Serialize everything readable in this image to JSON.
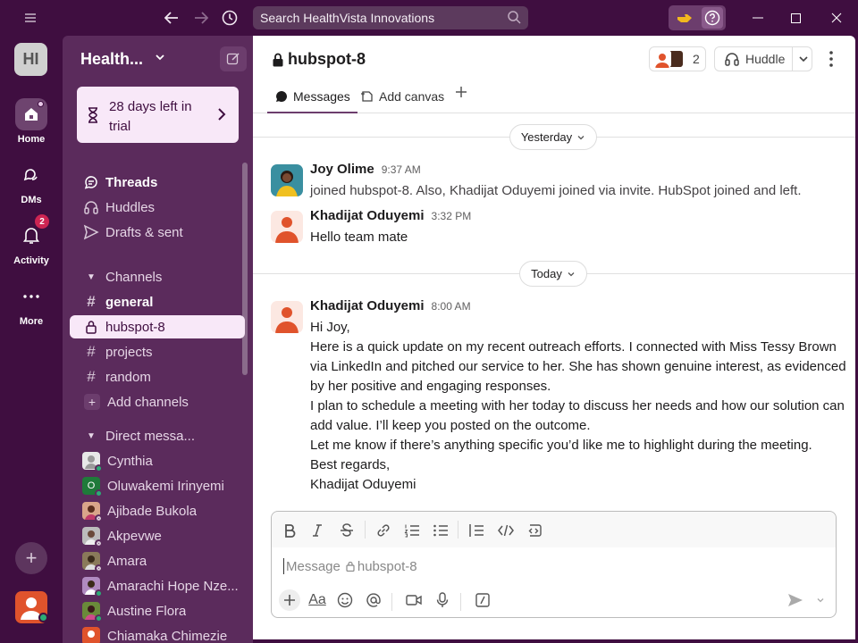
{
  "search": {
    "placeholder": "Search HealthVista Innovations"
  },
  "workspace": {
    "initials": "HI",
    "name": "Health..."
  },
  "rail": {
    "home": "Home",
    "dms": "DMs",
    "activity": "Activity",
    "activity_badge": "2",
    "more": "More"
  },
  "trial": {
    "text": "28 days left in trial"
  },
  "nav": {
    "threads": "Threads",
    "huddles": "Huddles",
    "drafts": "Drafts & sent"
  },
  "channels": {
    "header": "Channels",
    "items": [
      {
        "name": "general",
        "bold": true
      },
      {
        "name": "hubspot-8",
        "active": true
      },
      {
        "name": "projects"
      },
      {
        "name": "random"
      }
    ],
    "add": "Add channels"
  },
  "dms": {
    "header": "Direct messa...",
    "items": [
      {
        "name": "Cynthia"
      },
      {
        "name": "Oluwakemi Irinyemi",
        "initial": "O"
      },
      {
        "name": "Ajibade Bukola"
      },
      {
        "name": "Akpevwe"
      },
      {
        "name": "Amara"
      },
      {
        "name": "Amarachi Hope Nze..."
      },
      {
        "name": "Austine Flora"
      },
      {
        "name": "Chiamaka Chimezie"
      }
    ]
  },
  "channel": {
    "title": "hubspot-8",
    "member_count": "2",
    "huddle": "Huddle",
    "tabs": {
      "messages": "Messages",
      "canvas": "Add canvas"
    }
  },
  "dividers": {
    "yesterday": "Yesterday",
    "today": "Today"
  },
  "messages": [
    {
      "name": "Joy Olime",
      "time": "9:37 AM",
      "lines": [
        "joined hubspot-8. Also, Khadijat Oduyemi joined via invite. HubSpot joined and left."
      ]
    },
    {
      "name": "Khadijat Oduyemi",
      "time": "3:32 PM",
      "lines": [
        "Hello team mate"
      ]
    },
    {
      "name": "Khadijat Oduyemi",
      "time": "8:00 AM",
      "lines": [
        "Hi Joy,",
        "Here is a quick update on my recent outreach efforts. I connected with Miss Tessy Brown via LinkedIn and pitched our service to her. She has shown genuine interest, as evidenced by her positive and engaging responses.",
        "I plan to schedule a meeting with her today to discuss her needs and how our solution can add value. I’ll keep you posted on the outcome.",
        "Let me know if there’s anything specific you’d like me to highlight during the meeting.",
        "Best regards,",
        "Khadijat Oduyemi"
      ]
    }
  ],
  "composer": {
    "placeholder_prefix": "Message",
    "placeholder_channel": "hubspot-8",
    "aa": "Aa"
  },
  "colors": {
    "aubergine": "#3f0e40",
    "sidebar": "#5b2b5c",
    "active": "#f8e8f8",
    "badge": "#cd2553",
    "online": "#2bac76",
    "avatar_orange": "#e0532c"
  }
}
